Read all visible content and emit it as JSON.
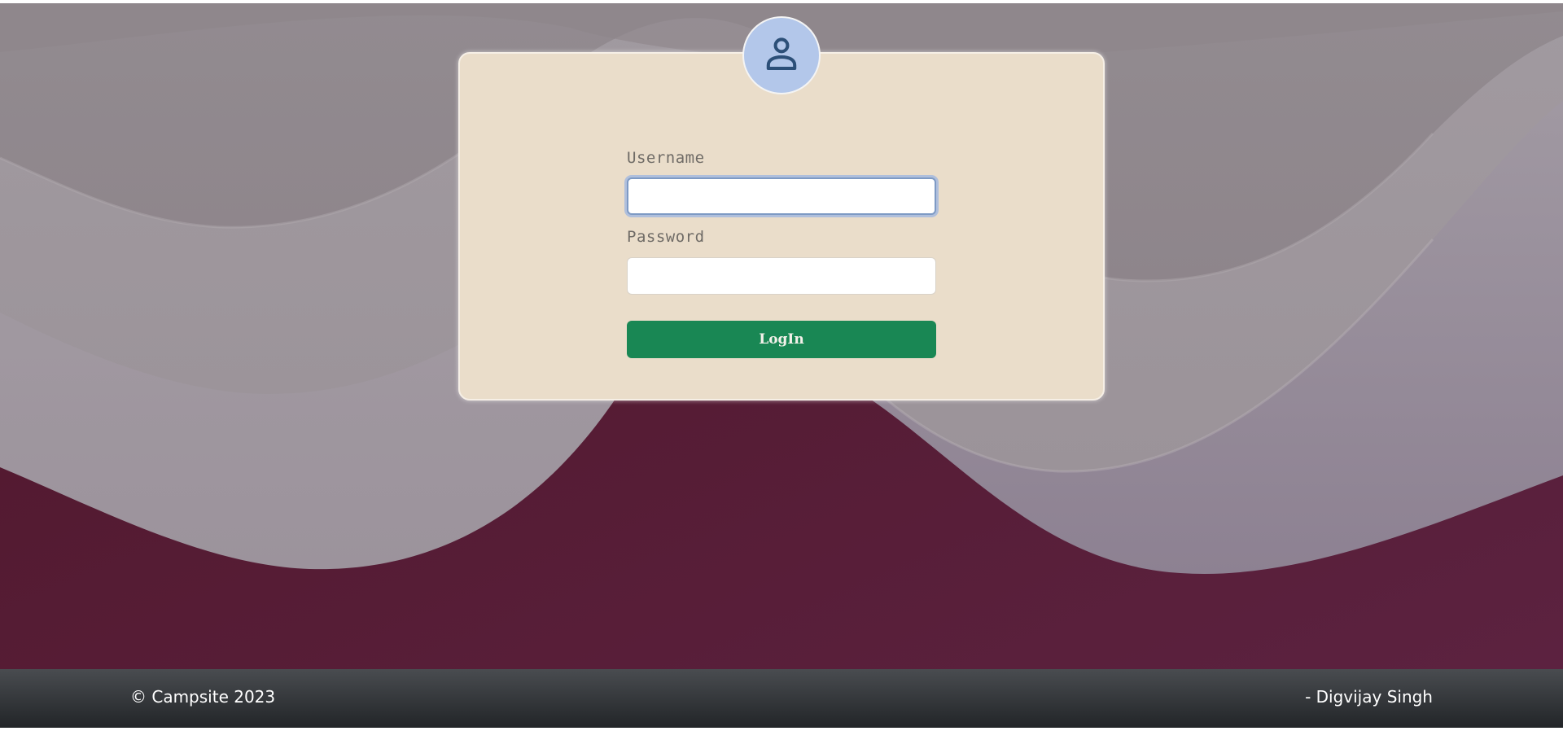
{
  "login": {
    "username_label": "Username",
    "username_value": "",
    "password_label": "Password",
    "password_value": "",
    "submit_label": "LogIn",
    "avatar_icon": "user-icon"
  },
  "footer": {
    "copyright": "© Campsite 2023",
    "author": "- Digvijay Singh"
  },
  "colors": {
    "card_background": "#eaddca",
    "avatar_background": "#b3c7ea",
    "button_background": "#198754",
    "footer_background": "#2f3236",
    "page_background_dark": "#581a36",
    "page_background_light": "#9a9096"
  }
}
